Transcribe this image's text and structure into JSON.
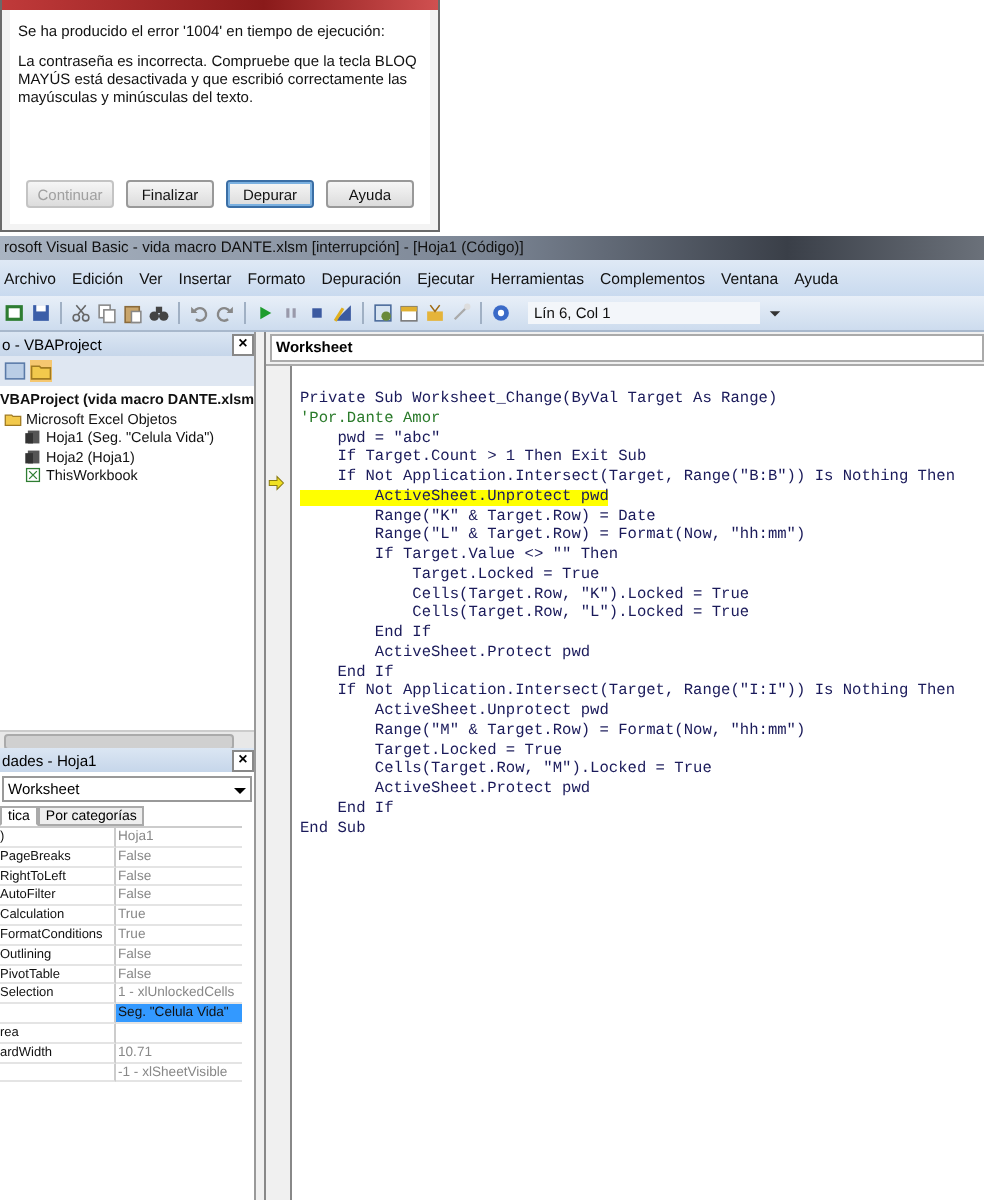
{
  "dialog": {
    "lines": [
      "Se ha producido el error '1004' en tiempo de ejecución:",
      "La contraseña es incorrecta. Compruebe que la tecla BLOQ MAYÚS está desactivada y que escribió correctamente las mayúsculas y minúsculas del texto."
    ],
    "buttons": [
      {
        "label": "Continuar",
        "disabled": true,
        "selected": false
      },
      {
        "label": "Finalizar",
        "disabled": false,
        "selected": false
      },
      {
        "label": "Depurar",
        "disabled": false,
        "selected": true
      },
      {
        "label": "Ayuda",
        "disabled": false,
        "selected": false
      }
    ]
  },
  "window": {
    "title": "rosoft Visual Basic - vida macro DANTE.xlsm [interrupción] - [Hoja1 (Código)]"
  },
  "menu": [
    "Archivo",
    "Edición",
    "Ver",
    "Insertar",
    "Formato",
    "Depuración",
    "Ejecutar",
    "Herramientas",
    "Complementos",
    "Ventana",
    "Ayuda"
  ],
  "toolbar": {
    "position": "Lín 6, Col 1"
  },
  "project": {
    "title": "o - VBAProject",
    "close": "×",
    "tree": [
      {
        "label": "VBAProject (vida macro DANTE.xlsm",
        "kind": "project",
        "children": [
          {
            "label": "Microsoft Excel Objetos",
            "kind": "folder",
            "children": [
              {
                "label": "Hoja1 (Seg. \"Celula Vida\")",
                "kind": "sheet"
              },
              {
                "label": "Hoja2 (Hoja1)",
                "kind": "sheet"
              },
              {
                "label": "ThisWorkbook",
                "kind": "workbook"
              }
            ]
          }
        ]
      }
    ]
  },
  "properties": {
    "title": "dades - Hoja1",
    "close": "×",
    "object": "Worksheet",
    "tabs": [
      {
        "label": "tica",
        "selected": true
      },
      {
        "label": "Por categorías",
        "selected": false
      }
    ],
    "rows": [
      {
        "name": ")",
        "value": "Hoja1",
        "selected": false
      },
      {
        "name": "PageBreaks",
        "value": "False",
        "selected": false
      },
      {
        "name": "RightToLeft",
        "value": "False",
        "selected": false
      },
      {
        "name": "AutoFilter",
        "value": "False",
        "selected": false
      },
      {
        "name": "Calculation",
        "value": "True",
        "selected": false
      },
      {
        "name": "FormatConditions",
        "value": "True",
        "selected": false
      },
      {
        "name": "Outlining",
        "value": "False",
        "selected": false
      },
      {
        "name": "PivotTable",
        "value": "False",
        "selected": false
      },
      {
        "name": "Selection",
        "value": "1 - xlUnlockedCells",
        "selected": false
      },
      {
        "value": "Seg. \"Celula Vida\"",
        "selected": true
      },
      {
        "name": "rea",
        "selected": false
      },
      {
        "name": "ardWidth",
        "value": "10.71",
        "selected": false
      },
      {
        "value": "-1 - xlSheetVisible",
        "selected": false
      }
    ]
  },
  "code": {
    "object": "Worksheet",
    "lines": [
      {
        "text": "Private Sub Worksheet_Change(ByVal Target As Range)",
        "kind": "code",
        "current": false
      },
      {
        "text": "'Por.Dante Amor",
        "kind": "comment",
        "current": false
      },
      {
        "text": "    pwd = \"abc\"",
        "kind": "code",
        "current": false
      },
      {
        "text": "    If Target.Count > 1 Then Exit Sub",
        "kind": "code",
        "current": false
      },
      {
        "text": "    If Not Application.Intersect(Target, Range(\"B:B\")) Is Nothing Then",
        "kind": "code",
        "current": false
      },
      {
        "text": "        ActiveSheet.Unprotect pwd",
        "kind": "code",
        "current": true
      },
      {
        "text": "        Range(\"K\" & Target.Row) = Date",
        "kind": "code",
        "current": false
      },
      {
        "text": "        Range(\"L\" & Target.Row) = Format(Now, \"hh:mm\")",
        "kind": "code",
        "current": false
      },
      {
        "text": "        If Target.Value <> \"\" Then",
        "kind": "code",
        "current": false
      },
      {
        "text": "            Target.Locked = True",
        "kind": "code",
        "current": false
      },
      {
        "text": "            Cells(Target.Row, \"K\").Locked = True",
        "kind": "code",
        "current": false
      },
      {
        "text": "            Cells(Target.Row, \"L\").Locked = True",
        "kind": "code",
        "current": false
      },
      {
        "text": "        End If",
        "kind": "code",
        "current": false
      },
      {
        "text": "        ActiveSheet.Protect pwd",
        "kind": "code",
        "current": false
      },
      {
        "text": "    End If",
        "kind": "code",
        "current": false
      },
      {
        "text": "    If Not Application.Intersect(Target, Range(\"I:I\")) Is Nothing Then",
        "kind": "code",
        "current": false
      },
      {
        "text": "        ActiveSheet.Unprotect pwd",
        "kind": "code",
        "current": false
      },
      {
        "text": "        Range(\"M\" & Target.Row) = Format(Now, \"hh:mm\")",
        "kind": "code",
        "current": false
      },
      {
        "text": "        Target.Locked = True",
        "kind": "code",
        "current": false
      },
      {
        "text": "        Cells(Target.Row, \"M\").Locked = True",
        "kind": "code",
        "current": false
      },
      {
        "text": "        ActiveSheet.Protect pwd",
        "kind": "code",
        "current": false
      },
      {
        "text": "    End If",
        "kind": "code",
        "current": false
      },
      {
        "text": "End Sub",
        "kind": "code",
        "current": false
      }
    ]
  }
}
